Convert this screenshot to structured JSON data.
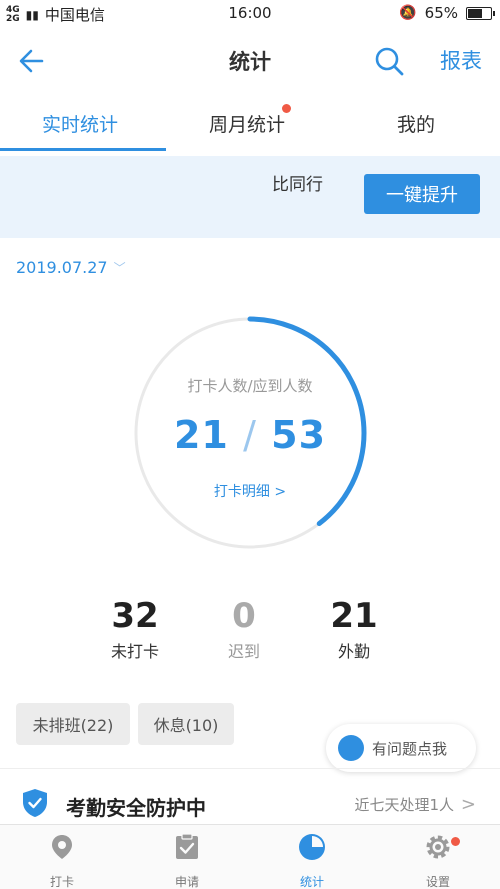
{
  "status_bar": {
    "signal_top": "4G",
    "signal_bottom": "2G",
    "carrier": "中国电信",
    "time": "16:00",
    "battery": "65%",
    "battery_level": 0.65
  },
  "header": {
    "title": "统计",
    "report_label": "报表"
  },
  "tabs": [
    {
      "label": "实时统计",
      "active": true,
      "dot": false
    },
    {
      "label": "周月统计",
      "active": false,
      "dot": true
    },
    {
      "label": "我的",
      "active": false,
      "dot": false
    }
  ],
  "banner": {
    "text": "比同行",
    "button_label": "一键提升"
  },
  "date": {
    "value": "2019.07.27"
  },
  "ring": {
    "label": "打卡人数/应到人数",
    "checked_in": "21",
    "total": "53",
    "separator": "/",
    "link_label": "打卡明细 >",
    "progress": 0.396,
    "color_active": "#2f8fe0",
    "color_track": "#e9e9e9"
  },
  "stats": [
    {
      "value": "32",
      "label": "未打卡"
    },
    {
      "value": "0",
      "label": "迟到"
    },
    {
      "value": "21",
      "label": "外勤"
    }
  ],
  "chips": [
    {
      "label": "未排班(22)"
    },
    {
      "label": "休息(10)"
    }
  ],
  "help": {
    "label": "有问题点我"
  },
  "security": {
    "title": "考勤安全防护中",
    "detail": "近七天处理1人",
    "chevron": ">"
  },
  "tabbar": [
    {
      "label": "打卡",
      "icon": "location-pin-icon",
      "active": false
    },
    {
      "label": "申请",
      "icon": "clipboard-check-icon",
      "active": false
    },
    {
      "label": "统计",
      "icon": "pie-chart-icon",
      "active": true
    },
    {
      "label": "设置",
      "icon": "gear-icon",
      "active": false,
      "badge": true
    }
  ],
  "colors": {
    "accent": "#2f8fe0",
    "badge": "#f05a45",
    "banner_bg": "#eaf3fc"
  }
}
